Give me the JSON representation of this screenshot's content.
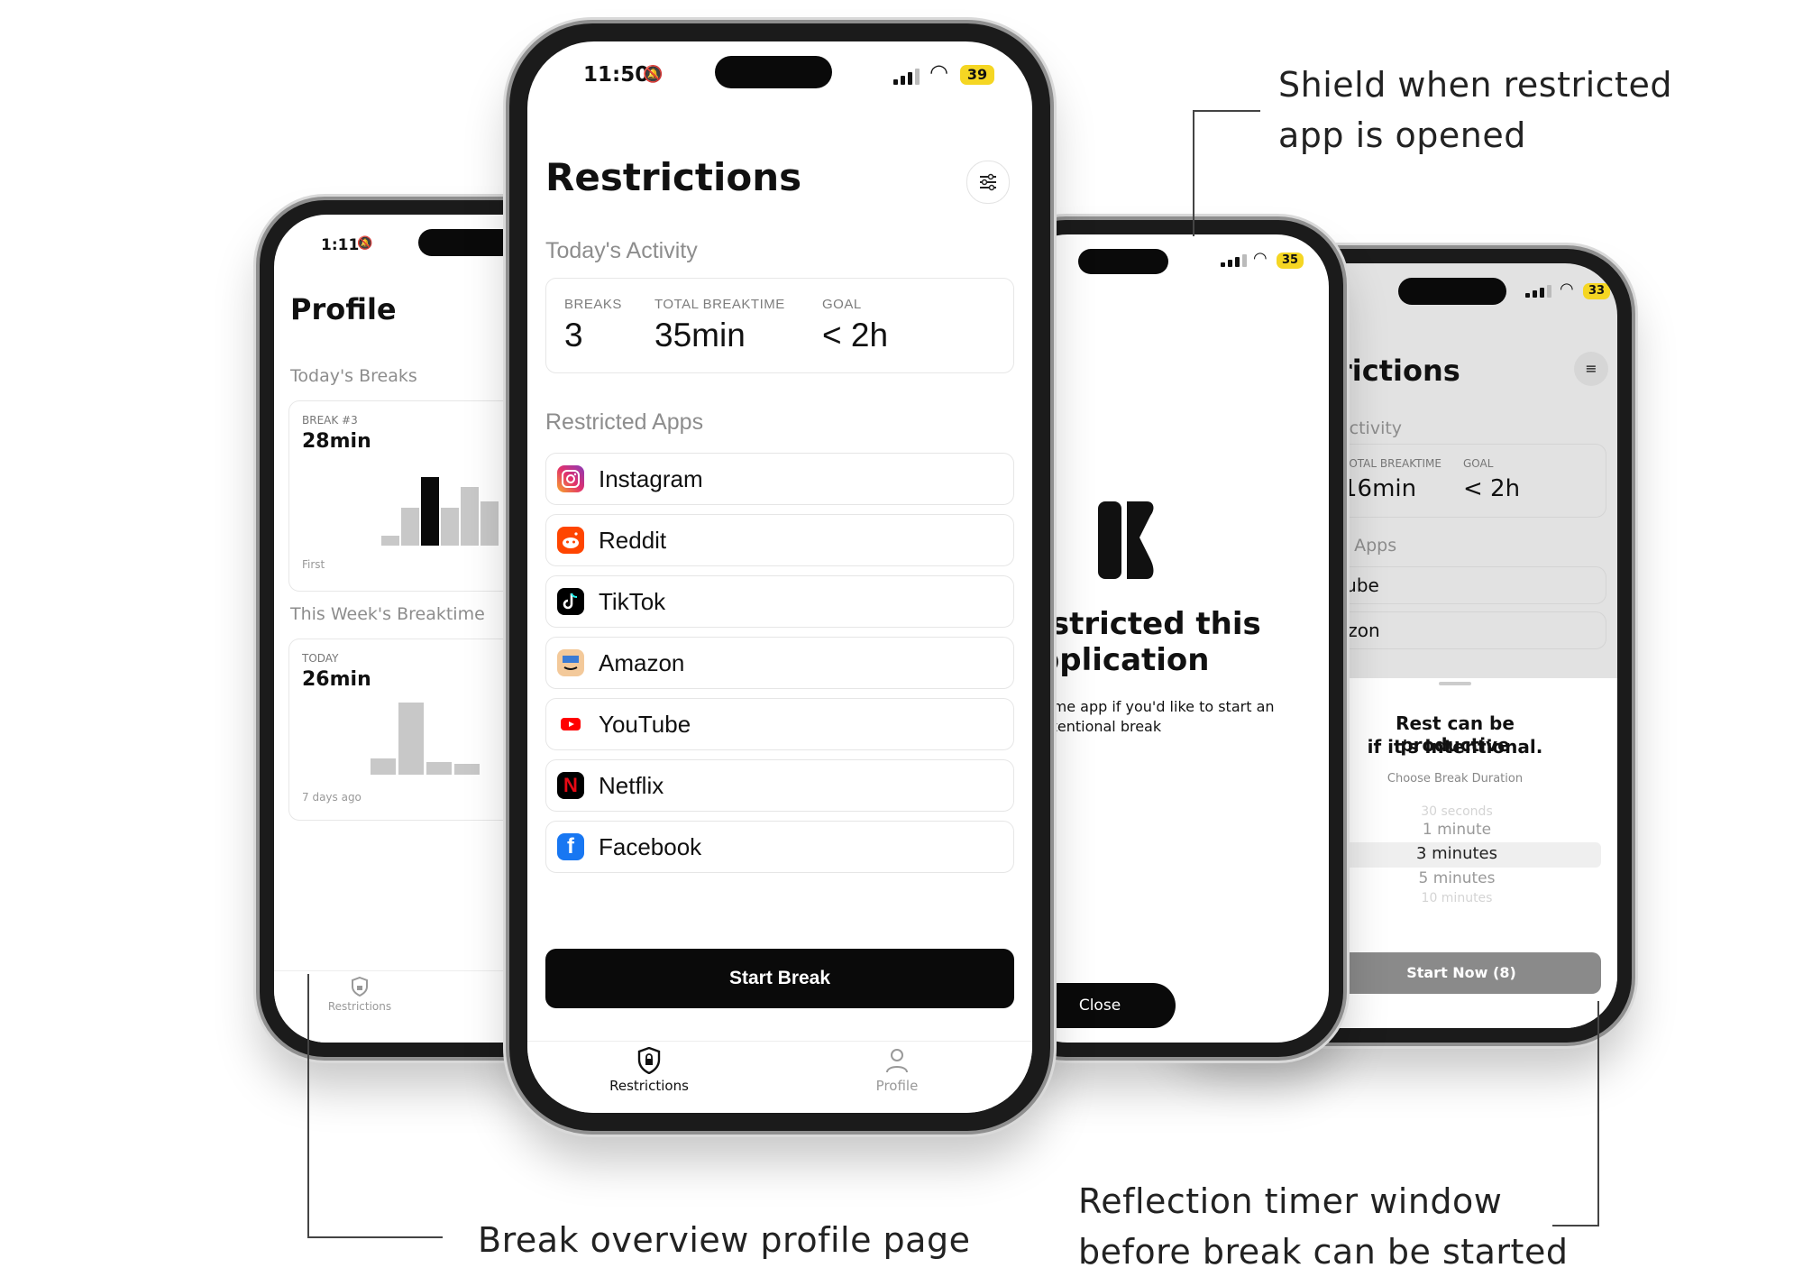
{
  "annotations": {
    "shield_line1": "Shield when restricted",
    "shield_line2": "app is opened",
    "profile": "Break overview profile page",
    "reflection_line1": "Reflection timer window",
    "reflection_line2": "before break can be started"
  },
  "profile_phone": {
    "time": "1:11",
    "title": "Profile",
    "todays_breaks_heading": "Today's Breaks",
    "break_card": {
      "label": "BREAK #3",
      "value": "28min",
      "axis_start": "First"
    },
    "week_heading": "This Week's Breaktime",
    "week_card": {
      "label": "TODAY",
      "value": "26min",
      "axis_start": "7 days ago"
    },
    "tab_label": "Restrictions",
    "bars_today": [
      0.15,
      0.55,
      1.0,
      0.55,
      0.85,
      0.65
    ],
    "bars_week": [
      0.22,
      1.0,
      0.18,
      0.15
    ]
  },
  "main_phone": {
    "time": "11:50",
    "battery": "39",
    "title": "Restrictions",
    "activity_heading": "Today's Activity",
    "stats": [
      {
        "label": "BREAKS",
        "value": "3"
      },
      {
        "label": "TOTAL BREAKTIME",
        "value": "35min"
      },
      {
        "label": "GOAL",
        "value": "< 2h"
      }
    ],
    "restricted_heading": "Restricted Apps",
    "apps": [
      {
        "name": "Instagram",
        "icon": "instagram-icon",
        "color": "#d6249f"
      },
      {
        "name": "Reddit",
        "icon": "reddit-icon",
        "color": "#ff4500"
      },
      {
        "name": "TikTok",
        "icon": "tiktok-icon",
        "color": "#000000"
      },
      {
        "name": "Amazon",
        "icon": "amazon-icon",
        "color": "#f3c99a"
      },
      {
        "name": "YouTube",
        "icon": "youtube-icon",
        "color": "#ff0000"
      },
      {
        "name": "Netflix",
        "icon": "netflix-icon",
        "color": "#e50914"
      },
      {
        "name": "Facebook",
        "icon": "facebook-icon",
        "color": "#1877f2"
      }
    ],
    "start_button": "Start Break",
    "tabs": [
      {
        "label": "Restrictions",
        "icon": "shield-lock-icon",
        "active": true
      },
      {
        "label": "Profile",
        "icon": "person-icon",
        "active": false
      }
    ]
  },
  "shield_phone": {
    "battery": "35",
    "heading_line1": "restricted this",
    "heading_line2": "application",
    "body_line1": "eaktime app if you'd like to start an",
    "body_line2": "intentional break",
    "close_button": "Close"
  },
  "reflection_phone": {
    "battery": "33",
    "title_partial": "rictions",
    "activity_partial": "Activity",
    "stats": [
      {
        "label": "TOTAL BREAKTIME",
        "value": "16min"
      },
      {
        "label": "GOAL",
        "value": "< 2h"
      }
    ],
    "apps_heading_partial": "d Apps",
    "app_rows_partial": [
      "Tube",
      "azon"
    ],
    "sheet": {
      "line1": "Rest can be productive",
      "line2": "if it's intentional.",
      "subtitle": "Choose Break Duration",
      "options": [
        "30 seconds",
        "1 minute",
        "3 minutes",
        "5 minutes",
        "10 minutes"
      ],
      "selected": "3 minutes",
      "button": "Start Now (8)"
    }
  }
}
